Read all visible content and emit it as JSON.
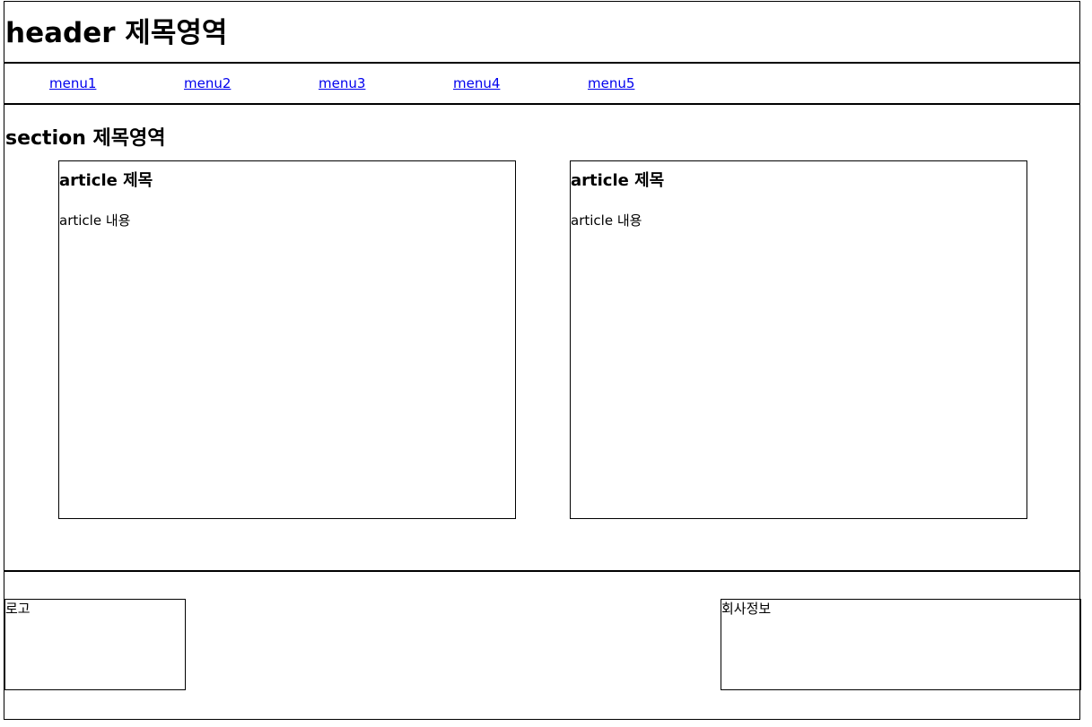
{
  "header": {
    "title": "header 제목영역"
  },
  "nav": {
    "items": [
      {
        "label": "menu1"
      },
      {
        "label": "menu2"
      },
      {
        "label": "menu3"
      },
      {
        "label": "menu4"
      },
      {
        "label": "menu5"
      }
    ]
  },
  "section": {
    "title": "section 제목영역",
    "articles": [
      {
        "title": "article 제목",
        "content": "article 내용"
      },
      {
        "title": "article 제목",
        "content": "article 내용"
      }
    ]
  },
  "footer": {
    "logo": "로고",
    "company_info": "회사정보"
  }
}
